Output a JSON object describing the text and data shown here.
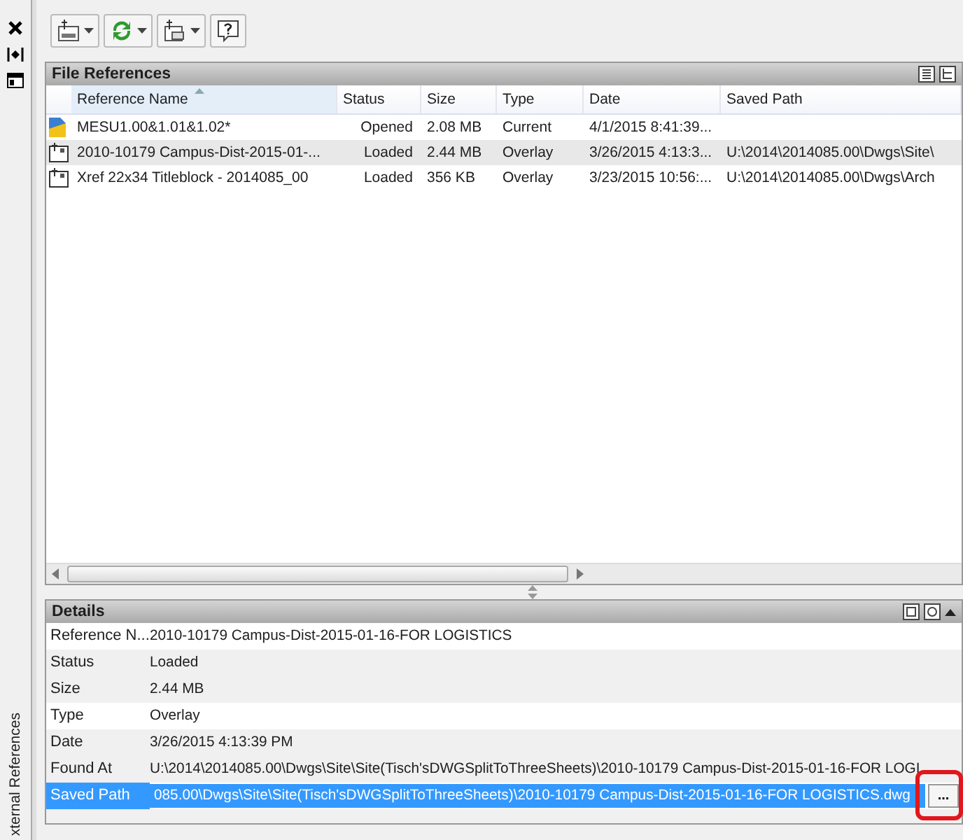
{
  "palette": {
    "title": "xternal References"
  },
  "toolbar": {
    "buttons": [
      {
        "kind": "attach",
        "dropdown": true
      },
      {
        "kind": "refresh",
        "dropdown": true
      },
      {
        "kind": "change-path",
        "dropdown": true
      },
      {
        "kind": "help",
        "dropdown": false
      }
    ]
  },
  "file_references": {
    "title": "File References",
    "columns": [
      {
        "label": "Reference Name",
        "sorted": true
      },
      {
        "label": "Status",
        "sorted": false
      },
      {
        "label": "Size",
        "sorted": false
      },
      {
        "label": "Type",
        "sorted": false
      },
      {
        "label": "Date",
        "sorted": false
      },
      {
        "label": "Saved Path",
        "sorted": false
      }
    ],
    "rows": [
      {
        "kind": "current",
        "selected": false,
        "cells": [
          "MESU1.00&1.01&1.02*",
          "Opened",
          "2.08 MB",
          "Current",
          "4/1/2015 8:41:39...",
          ""
        ]
      },
      {
        "kind": "xref",
        "selected": true,
        "cells": [
          "2010-10179 Campus-Dist-2015-01-...",
          "Loaded",
          "2.44 MB",
          "Overlay",
          "3/26/2015 4:13:3...",
          "U:\\2014\\2014085.00\\Dwgs\\Site\\"
        ]
      },
      {
        "kind": "xref",
        "selected": false,
        "cells": [
          "Xref 22x34 Titleblock - 2014085_00",
          "Loaded",
          "356 KB",
          "Overlay",
          "3/23/2015 10:56:...",
          "U:\\2014\\2014085.00\\Dwgs\\Arch"
        ]
      }
    ]
  },
  "details": {
    "title": "Details",
    "rows": [
      {
        "label": "Reference N...",
        "value": "2010-10179 Campus-Dist-2015-01-16-FOR LOGISTICS",
        "kind": "text",
        "selected": false
      },
      {
        "label": "Status",
        "value": "Loaded",
        "kind": "text",
        "selected": false
      },
      {
        "label": "Size",
        "value": "2.44 MB",
        "kind": "text",
        "selected": false
      },
      {
        "label": "Type",
        "value": "Overlay",
        "kind": "text",
        "selected": false
      },
      {
        "label": "Date",
        "value": "3/26/2015 4:13:39 PM",
        "kind": "text",
        "selected": false
      },
      {
        "label": "Found At",
        "value": "U:\\2014\\2014085.00\\Dwgs\\Site\\Site(Tisch'sDWGSplitToThreeSheets)\\2010-10179 Campus-Dist-2015-01-16-FOR LOGI",
        "kind": "text",
        "selected": false
      },
      {
        "label": "Saved Path",
        "value": "085.00\\Dwgs\\Site\\Site(Tisch'sDWGSplitToThreeSheets)\\2010-10179 Campus-Dist-2015-01-16-FOR LOGISTICS.dwg",
        "kind": "input",
        "selected": true,
        "browse": "..."
      }
    ]
  },
  "annotation": {
    "shown": true
  }
}
